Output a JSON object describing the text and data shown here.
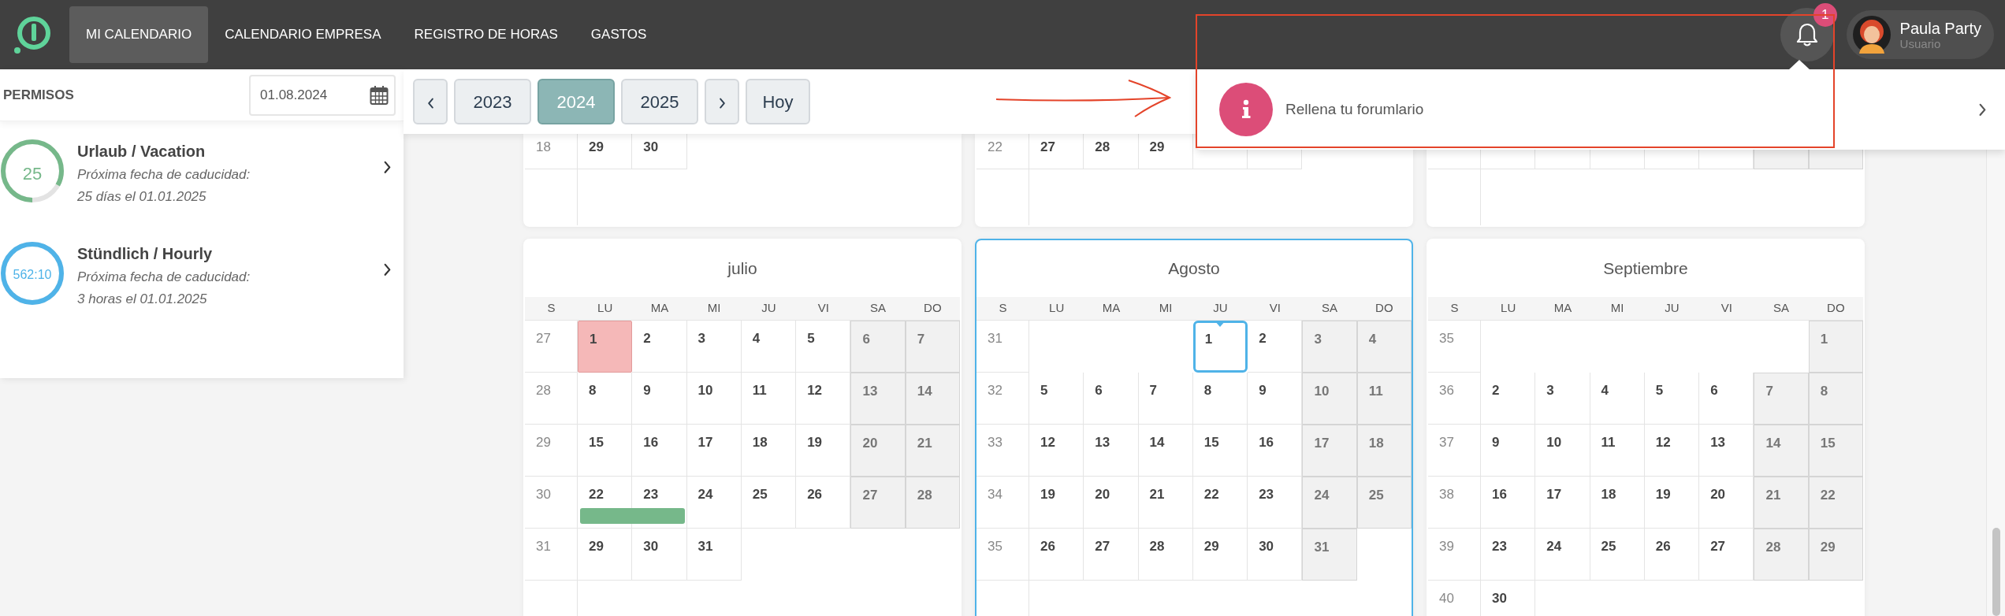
{
  "nav": {
    "items": [
      {
        "label": "MI CALENDARIO",
        "selected": true
      },
      {
        "label": "CALENDARIO EMPRESA",
        "selected": false
      },
      {
        "label": "REGISTRO DE HORAS",
        "selected": false
      },
      {
        "label": "GASTOS",
        "selected": false
      }
    ]
  },
  "notifications": {
    "count": "1"
  },
  "user": {
    "name": "Paula Party",
    "role": "Usuario"
  },
  "sidebar": {
    "title": "PERMISOS",
    "date_field": {
      "value": "01.08.2024"
    },
    "balances": [
      {
        "value": "25",
        "title": "Urlaub / Vacation",
        "note_1": "Próxima fecha de caducidad:",
        "note_2": "25 días el 01.01.2025",
        "color": "#76b88a",
        "level": 0.83
      },
      {
        "value": "562:10",
        "title": "Stündlich / Hourly",
        "note_1": "Próxima fecha de caducidad:",
        "note_2": "3 horas el 01.01.2025",
        "color": "#4fb3e8",
        "level": 1
      }
    ]
  },
  "year_nav": {
    "years": [
      {
        "label": "2023",
        "selected": false
      },
      {
        "label": "2024",
        "selected": true
      },
      {
        "label": "2025",
        "selected": false
      }
    ],
    "today": "Hoy"
  },
  "dropdown": {
    "items": [
      {
        "text": "Rellena tu forumlario"
      }
    ]
  },
  "upper_calendars": [
    {
      "weeks": [
        {
          "week": "18",
          "days": [
            {
              "kind": "day",
              "day": "29"
            },
            {
              "kind": "day",
              "day": "30"
            },
            {
              "kind": "blank"
            },
            {
              "kind": "blank"
            },
            {
              "kind": "blank"
            },
            {
              "kind": "blank"
            },
            {
              "kind": "blank"
            }
          ]
        },
        {
          "days": [
            {
              "kind": "blank"
            },
            {
              "kind": "blank"
            },
            {
              "kind": "blank"
            },
            {
              "kind": "blank"
            },
            {
              "kind": "blank"
            },
            {
              "kind": "blank"
            },
            {
              "kind": "blank"
            }
          ]
        }
      ]
    },
    {
      "weeks": [
        {
          "week": "22",
          "days": [
            {
              "kind": "day",
              "day": "27"
            },
            {
              "kind": "day",
              "day": "28"
            },
            {
              "kind": "day",
              "day": "29"
            },
            {
              "kind": "covered"
            },
            {
              "kind": "covered"
            },
            {
              "kind": "blank"
            },
            {
              "kind": "blank"
            }
          ]
        },
        {
          "days": [
            {
              "kind": "blank"
            },
            {
              "kind": "blank"
            },
            {
              "kind": "blank"
            },
            {
              "kind": "blank"
            },
            {
              "kind": "blank"
            },
            {
              "kind": "blank"
            },
            {
              "kind": "blank"
            }
          ]
        }
      ]
    },
    {
      "weeks": [
        {
          "days": [
            {
              "kind": "covered"
            },
            {
              "kind": "covered"
            },
            {
              "kind": "covered"
            },
            {
              "kind": "covered"
            },
            {
              "kind": "covered"
            },
            {
              "kind": "covered_weekend"
            },
            {
              "kind": "covered_weekend"
            }
          ]
        },
        {
          "days": [
            {
              "kind": "blank"
            },
            {
              "kind": "blank"
            },
            {
              "kind": "blank"
            },
            {
              "kind": "blank"
            },
            {
              "kind": "blank"
            },
            {
              "kind": "blank"
            },
            {
              "kind": "blank"
            }
          ]
        }
      ]
    }
  ],
  "calendars": [
    {
      "title": "julio",
      "selected": false,
      "weekdays": [
        "S",
        "LU",
        "MA",
        "MI",
        "JU",
        "VI",
        "SA",
        "DO"
      ],
      "weeks": [
        {
          "week": "27",
          "days": [
            {
              "kind": "holiday",
              "day": "1"
            },
            {
              "kind": "day",
              "day": "2"
            },
            {
              "kind": "day",
              "day": "3"
            },
            {
              "kind": "day",
              "day": "4"
            },
            {
              "kind": "day",
              "day": "5"
            },
            {
              "kind": "weekend",
              "day": "6"
            },
            {
              "kind": "weekend",
              "day": "7"
            }
          ]
        },
        {
          "week": "28",
          "days": [
            {
              "kind": "day",
              "day": "8"
            },
            {
              "kind": "day",
              "day": "9"
            },
            {
              "kind": "day",
              "day": "10"
            },
            {
              "kind": "day",
              "day": "11"
            },
            {
              "kind": "day",
              "day": "12"
            },
            {
              "kind": "weekend",
              "day": "13"
            },
            {
              "kind": "weekend",
              "day": "14"
            }
          ]
        },
        {
          "week": "29",
          "days": [
            {
              "kind": "day",
              "day": "15"
            },
            {
              "kind": "day",
              "day": "16"
            },
            {
              "kind": "day",
              "day": "17"
            },
            {
              "kind": "day",
              "day": "18"
            },
            {
              "kind": "day",
              "day": "19"
            },
            {
              "kind": "weekend",
              "day": "20"
            },
            {
              "kind": "weekend",
              "day": "21"
            }
          ]
        },
        {
          "week": "30",
          "days": [
            {
              "kind": "event",
              "day": "22"
            },
            {
              "kind": "event",
              "day": "23"
            },
            {
              "kind": "day",
              "day": "24"
            },
            {
              "kind": "day",
              "day": "25"
            },
            {
              "kind": "day",
              "day": "26"
            },
            {
              "kind": "weekend",
              "day": "27"
            },
            {
              "kind": "weekend",
              "day": "28"
            }
          ]
        },
        {
          "week": "31",
          "days": [
            {
              "kind": "day",
              "day": "29"
            },
            {
              "kind": "day",
              "day": "30"
            },
            {
              "kind": "day",
              "day": "31"
            },
            {
              "kind": "blank"
            },
            {
              "kind": "blank"
            },
            {
              "kind": "blank"
            },
            {
              "kind": "blank"
            }
          ]
        },
        {
          "days": [
            {
              "kind": "blank"
            },
            {
              "kind": "blank"
            },
            {
              "kind": "blank"
            },
            {
              "kind": "blank"
            },
            {
              "kind": "blank"
            },
            {
              "kind": "blank"
            },
            {
              "kind": "blank"
            }
          ]
        }
      ]
    },
    {
      "title": "Agosto",
      "selected": true,
      "weekdays": [
        "S",
        "LU",
        "MA",
        "MI",
        "JU",
        "VI",
        "SA",
        "DO"
      ],
      "weeks": [
        {
          "week": "31",
          "days": [
            {
              "kind": "blank"
            },
            {
              "kind": "blank"
            },
            {
              "kind": "blank"
            },
            {
              "kind": "today",
              "day": "1"
            },
            {
              "kind": "day",
              "day": "2"
            },
            {
              "kind": "weekend",
              "day": "3"
            },
            {
              "kind": "weekend",
              "day": "4"
            }
          ]
        },
        {
          "week": "32",
          "days": [
            {
              "kind": "day",
              "day": "5"
            },
            {
              "kind": "day",
              "day": "6"
            },
            {
              "kind": "day",
              "day": "7"
            },
            {
              "kind": "day",
              "day": "8"
            },
            {
              "kind": "day",
              "day": "9"
            },
            {
              "kind": "weekend",
              "day": "10"
            },
            {
              "kind": "weekend",
              "day": "11"
            }
          ]
        },
        {
          "week": "33",
          "days": [
            {
              "kind": "day",
              "day": "12"
            },
            {
              "kind": "day",
              "day": "13"
            },
            {
              "kind": "day",
              "day": "14"
            },
            {
              "kind": "day",
              "day": "15"
            },
            {
              "kind": "day",
              "day": "16"
            },
            {
              "kind": "weekend",
              "day": "17"
            },
            {
              "kind": "weekend",
              "day": "18"
            }
          ]
        },
        {
          "week": "34",
          "days": [
            {
              "kind": "day",
              "day": "19"
            },
            {
              "kind": "day",
              "day": "20"
            },
            {
              "kind": "day",
              "day": "21"
            },
            {
              "kind": "day",
              "day": "22"
            },
            {
              "kind": "day",
              "day": "23"
            },
            {
              "kind": "weekend",
              "day": "24"
            },
            {
              "kind": "weekend",
              "day": "25"
            }
          ]
        },
        {
          "week": "35",
          "days": [
            {
              "kind": "day",
              "day": "26"
            },
            {
              "kind": "day",
              "day": "27"
            },
            {
              "kind": "day",
              "day": "28"
            },
            {
              "kind": "day",
              "day": "29"
            },
            {
              "kind": "day",
              "day": "30"
            },
            {
              "kind": "weekend",
              "day": "31"
            },
            {
              "kind": "blank"
            }
          ]
        },
        {
          "days": [
            {
              "kind": "blank"
            },
            {
              "kind": "blank"
            },
            {
              "kind": "blank"
            },
            {
              "kind": "blank"
            },
            {
              "kind": "blank"
            },
            {
              "kind": "blank"
            },
            {
              "kind": "blank"
            }
          ]
        }
      ]
    },
    {
      "title": "Septiembre",
      "selected": false,
      "weekdays": [
        "S",
        "LU",
        "MA",
        "MI",
        "JU",
        "VI",
        "SA",
        "DO"
      ],
      "weeks": [
        {
          "week": "35",
          "days": [
            {
              "kind": "blank"
            },
            {
              "kind": "blank"
            },
            {
              "kind": "blank"
            },
            {
              "kind": "blank"
            },
            {
              "kind": "blank"
            },
            {
              "kind": "blank"
            },
            {
              "kind": "weekend",
              "day": "1"
            }
          ]
        },
        {
          "week": "36",
          "days": [
            {
              "kind": "day",
              "day": "2"
            },
            {
              "kind": "day",
              "day": "3"
            },
            {
              "kind": "day",
              "day": "4"
            },
            {
              "kind": "day",
              "day": "5"
            },
            {
              "kind": "day",
              "day": "6"
            },
            {
              "kind": "weekend",
              "day": "7"
            },
            {
              "kind": "weekend",
              "day": "8"
            }
          ]
        },
        {
          "week": "37",
          "days": [
            {
              "kind": "day",
              "day": "9"
            },
            {
              "kind": "day",
              "day": "10"
            },
            {
              "kind": "day",
              "day": "11"
            },
            {
              "kind": "day",
              "day": "12"
            },
            {
              "kind": "day",
              "day": "13"
            },
            {
              "kind": "weekend",
              "day": "14"
            },
            {
              "kind": "weekend",
              "day": "15"
            }
          ]
        },
        {
          "week": "38",
          "days": [
            {
              "kind": "day",
              "day": "16"
            },
            {
              "kind": "day",
              "day": "17"
            },
            {
              "kind": "day",
              "day": "18"
            },
            {
              "kind": "day",
              "day": "19"
            },
            {
              "kind": "day",
              "day": "20"
            },
            {
              "kind": "weekend",
              "day": "21"
            },
            {
              "kind": "weekend",
              "day": "22"
            }
          ]
        },
        {
          "week": "39",
          "days": [
            {
              "kind": "day",
              "day": "23"
            },
            {
              "kind": "day",
              "day": "24"
            },
            {
              "kind": "day",
              "day": "25"
            },
            {
              "kind": "day",
              "day": "26"
            },
            {
              "kind": "day",
              "day": "27"
            },
            {
              "kind": "weekend",
              "day": "28"
            },
            {
              "kind": "weekend",
              "day": "29"
            }
          ]
        },
        {
          "week": "40",
          "days": [
            {
              "kind": "day",
              "day": "30"
            },
            {
              "kind": "blank"
            },
            {
              "kind": "blank"
            },
            {
              "kind": "blank"
            },
            {
              "kind": "blank"
            },
            {
              "kind": "blank"
            },
            {
              "kind": "blank"
            }
          ]
        }
      ]
    }
  ]
}
